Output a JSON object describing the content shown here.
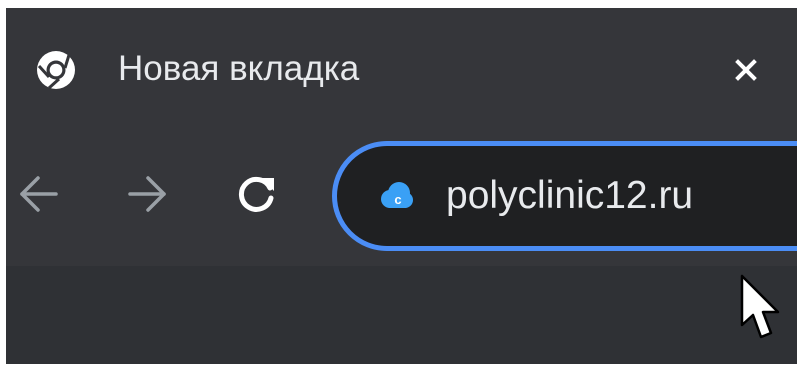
{
  "tab": {
    "icon": "chrome-icon",
    "title": "Новая вкладка",
    "close_icon": "close-icon"
  },
  "toolbar": {
    "back_icon": "arrow-left-icon",
    "forward_icon": "arrow-right-icon",
    "reload_icon": "reload-icon"
  },
  "omnibox": {
    "site_icon": "site-cloud-icon",
    "value": "polyclinic12.ru"
  },
  "cursor": {
    "icon": "mouse-pointer-icon"
  },
  "colors": {
    "tab_strip_bg": "#35363a",
    "omnibox_border": "#4b8df5",
    "omnibox_bg": "#1f2022",
    "text": "#e8eaed",
    "disabled_icon": "#9aa0a6",
    "site_icon": "#3aa0f5"
  }
}
